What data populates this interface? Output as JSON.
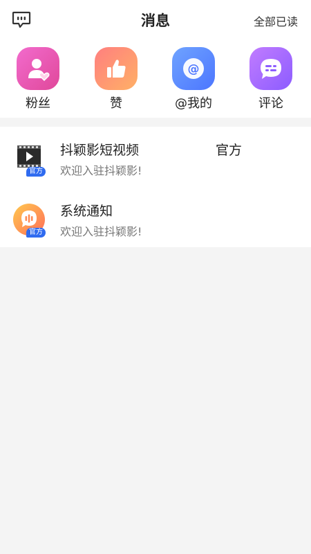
{
  "header": {
    "title": "消息",
    "read_all": "全部已读"
  },
  "quick_actions": [
    {
      "label": "粉丝",
      "icon": "fan-person-icon"
    },
    {
      "label": "赞",
      "icon": "thumbs-up-icon"
    },
    {
      "label": "@我的",
      "icon": "at-mention-icon"
    },
    {
      "label": "评论",
      "icon": "comment-bubble-icon"
    }
  ],
  "messages": [
    {
      "name": "抖颖影短视频",
      "tag": "官方",
      "badge": "官方",
      "preview": "欢迎入驻抖颖影!",
      "icon": "video-film-icon"
    },
    {
      "name": "系统通知",
      "tag": "",
      "badge": "官方",
      "preview": "欢迎入驻抖颖影!",
      "icon": "system-voice-icon"
    }
  ],
  "colors": {
    "fans": "#e0489a",
    "like": "#ff9966",
    "at": "#4c76ff",
    "comment": "#8c5cff",
    "badge": "#2f6bf0",
    "background": "#f4f4f4"
  }
}
